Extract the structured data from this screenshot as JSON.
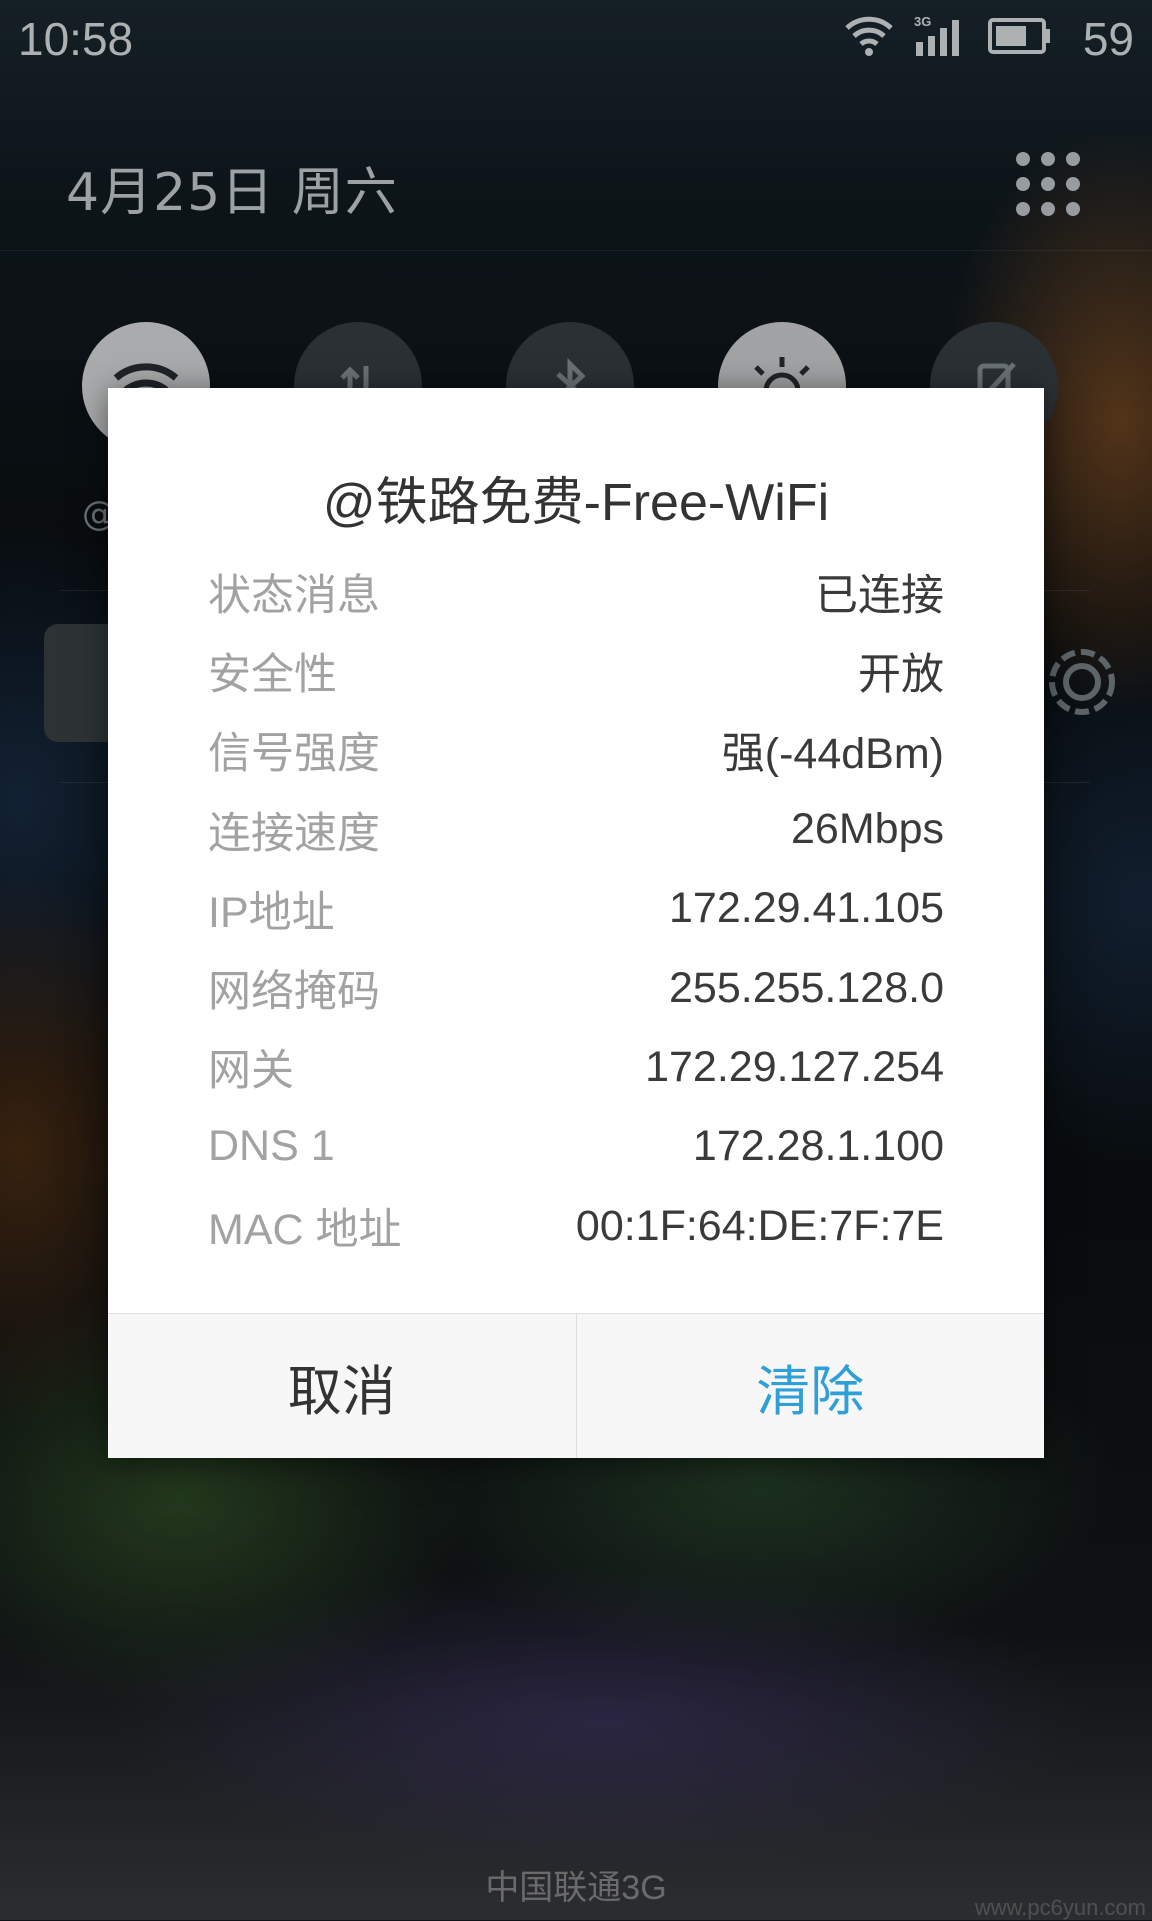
{
  "status_bar": {
    "time": "10:58",
    "network_type": "3G",
    "battery_percent": "59",
    "icons": [
      "wifi-icon",
      "cellular-3g-icon",
      "battery-icon"
    ]
  },
  "header": {
    "date": "4月25日  周六",
    "grid_icon": "apps-grid-icon"
  },
  "quick_toggles": [
    {
      "name": "wifi",
      "icon": "wifi-icon",
      "on": true
    },
    {
      "name": "mobile-data",
      "icon": "data-arrows-icon",
      "on": false
    },
    {
      "name": "bluetooth",
      "icon": "bluetooth-icon",
      "on": false
    },
    {
      "name": "auto-brightness",
      "icon": "brightness-icon",
      "on": true
    },
    {
      "name": "rotation-lock",
      "icon": "rotation-lock-icon",
      "on": false
    }
  ],
  "toggle_label_partial": "@",
  "dialog": {
    "title": "@铁路免费-Free-WiFi",
    "rows": [
      {
        "label": "状态消息",
        "value": "已连接"
      },
      {
        "label": "安全性",
        "value": "开放"
      },
      {
        "label": "信号强度",
        "value": "强(-44dBm)"
      },
      {
        "label": "连接速度",
        "value": "26Mbps"
      },
      {
        "label": "IP地址",
        "value": "172.29.41.105"
      },
      {
        "label": "网络掩码",
        "value": "255.255.128.0"
      },
      {
        "label": "网关",
        "value": "172.29.127.254"
      },
      {
        "label": "DNS 1",
        "value": "172.28.1.100"
      },
      {
        "label": "MAC 地址",
        "value": "00:1F:64:DE:7F:7E"
      }
    ],
    "cancel_label": "取消",
    "clear_label": "清除"
  },
  "carrier": "中国联通3G",
  "watermark": "www.pc6yun.com",
  "colors": {
    "accent": "#2f9fd8",
    "label_gray": "#a2a2a2",
    "value_dark": "#3a3a3a"
  }
}
